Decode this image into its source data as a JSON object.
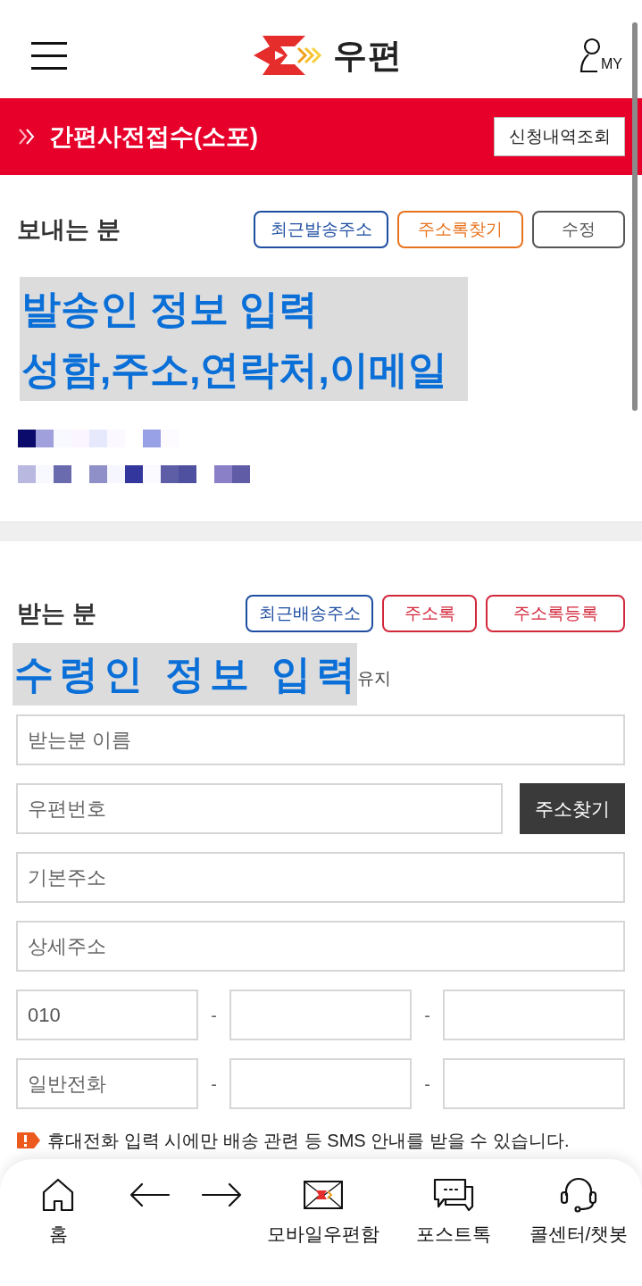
{
  "header": {
    "logo_text": "우편",
    "my_label": "MY"
  },
  "banner": {
    "title": "간편사전접수(소포)",
    "button": "신청내역조회"
  },
  "sender": {
    "title": "보내는 분",
    "buttons": [
      {
        "label": "최근발송주소",
        "color": "#1f4ea1"
      },
      {
        "label": "주소록찾기",
        "color": "#e8731e"
      },
      {
        "label": "수정",
        "color": "#555555"
      }
    ],
    "annotation": [
      "발송인 정보 입력",
      "성함,주소,연락처,이메일"
    ]
  },
  "receiver": {
    "title": "받는 분",
    "buttons": [
      {
        "label": "최근배송주소",
        "color": "#1f4ea1"
      },
      {
        "label": "주소록",
        "color": "#d2283c"
      },
      {
        "label": "주소록등록",
        "color": "#d2283c"
      }
    ],
    "annotation": "수령인 정보 입력",
    "partial_text": "유지",
    "name_field": {
      "placeholder": "받는분 이름"
    },
    "postcode_field": {
      "placeholder": "우편번호"
    },
    "address_button": "주소찾기",
    "base_address_field": {
      "placeholder": "기본주소"
    },
    "detail_address_field": {
      "placeholder": "상세주소"
    },
    "phone_rows": [
      {
        "first": {
          "value": "010"
        },
        "separators": [
          "-",
          "-"
        ]
      },
      {
        "first": {
          "placeholder": "일반전화"
        },
        "separators": [
          "-",
          "-"
        ]
      }
    ],
    "notice": "휴대전화 입력 시에만 배송 관련 등 SMS 안내를 받을 수 있습니다."
  },
  "bottom_nav": [
    {
      "kind": "home",
      "label": "홈"
    },
    {
      "kind": "back"
    },
    {
      "kind": "forward"
    },
    {
      "kind": "mailbox",
      "label": "모바일우편함"
    },
    {
      "kind": "chat",
      "label": "포스트톡"
    },
    {
      "kind": "headset",
      "label": "콜센터/챗봇"
    }
  ]
}
